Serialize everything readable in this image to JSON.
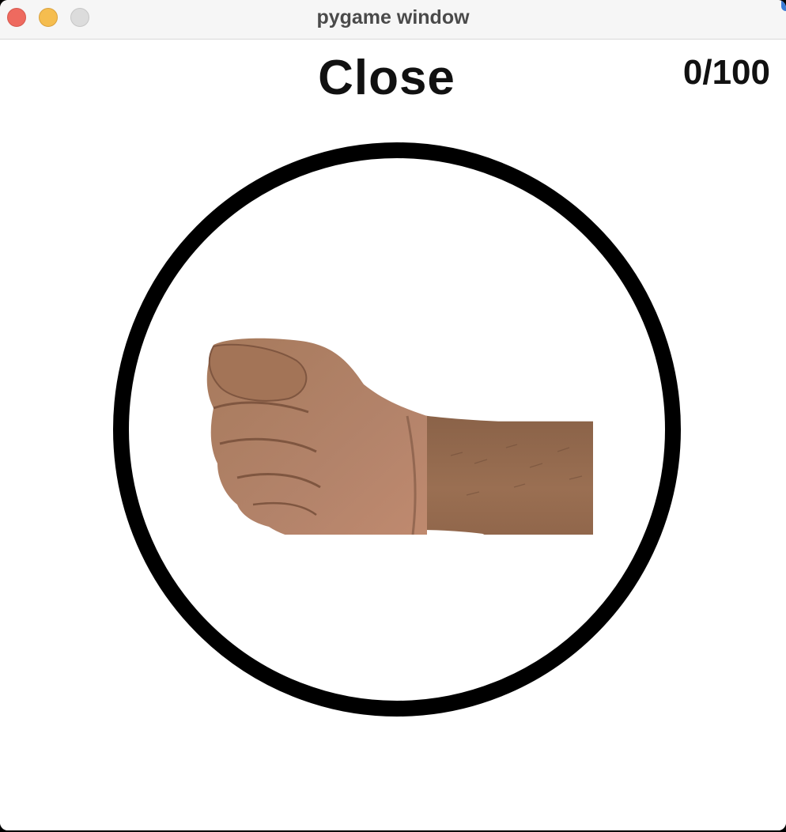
{
  "window": {
    "title": "pygame window"
  },
  "game": {
    "gesture_prompt": "Close",
    "score": "0/100",
    "hand_image": "closed-fist-hand"
  },
  "colors": {
    "ring": "#000000",
    "background": "#ffffff",
    "text": "#111111",
    "close_button": "#ee6a5f",
    "minimize_button": "#f5bd4f",
    "zoom_button": "#dcdcdc"
  }
}
